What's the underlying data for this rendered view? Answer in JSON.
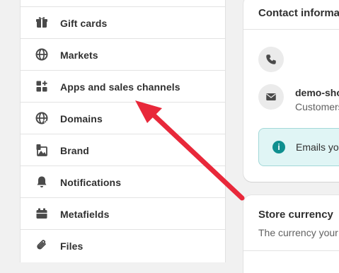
{
  "sidebar": {
    "items": [
      {
        "label": "Gift cards",
        "icon": "gift-card-icon"
      },
      {
        "label": "Markets",
        "icon": "globe-icon"
      },
      {
        "label": "Apps and sales channels",
        "icon": "apps-icon"
      },
      {
        "label": "Domains",
        "icon": "domains-globe-icon"
      },
      {
        "label": "Brand",
        "icon": "brand-icon"
      },
      {
        "label": "Notifications",
        "icon": "bell-icon"
      },
      {
        "label": "Metafields",
        "icon": "metafields-icon"
      },
      {
        "label": "Files",
        "icon": "paperclip-icon"
      }
    ]
  },
  "contact": {
    "title": "Contact informa",
    "email_name": "demo-sho",
    "email_sub": "Customers",
    "banner_text": "Emails you"
  },
  "currency": {
    "title": "Store currency",
    "description": "The currency your"
  },
  "annotation": {
    "arrow_color": "#e8283a"
  }
}
